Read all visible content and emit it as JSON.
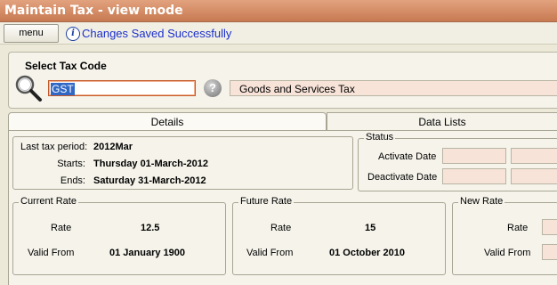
{
  "window": {
    "title": "Maintain Tax - view mode"
  },
  "toolbar": {
    "menu_label": "menu",
    "status_message": "Changes Saved Successfully"
  },
  "select_tax": {
    "title": "Select Tax Code",
    "code": "GST",
    "description": "Goods and Services Tax"
  },
  "tabs": [
    {
      "label": "Details"
    },
    {
      "label": "Data Lists"
    }
  ],
  "period": {
    "last_label": "Last tax period:",
    "last_value": "2012Mar",
    "starts_label": "Starts:",
    "starts_value": "Thursday 01-March-2012",
    "ends_label": "Ends:",
    "ends_value": "Saturday 31-March-2012"
  },
  "status": {
    "title": "Status",
    "activate_label": "Activate Date",
    "deactivate_label": "Deactivate Date"
  },
  "current_rate": {
    "title": "Current Rate",
    "rate_label": "Rate",
    "rate_value": "12.5",
    "valid_label": "Valid From",
    "valid_value": "01 January 1900"
  },
  "future_rate": {
    "title": "Future Rate",
    "rate_label": "Rate",
    "rate_value": "15",
    "valid_label": "Valid From",
    "valid_value": "01 October 2010"
  },
  "new_rate": {
    "title": "New Rate",
    "rate_label": "Rate",
    "valid_label": "Valid From"
  }
}
